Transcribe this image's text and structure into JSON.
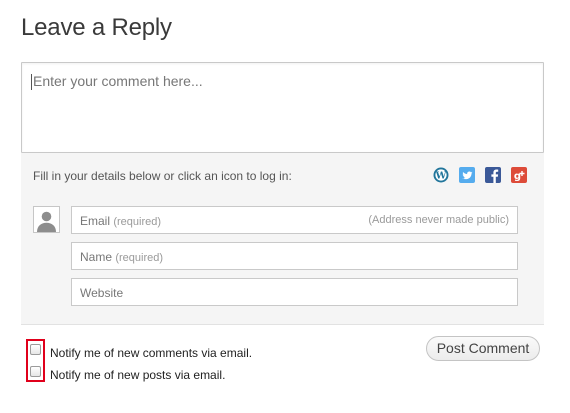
{
  "heading": "Leave a Reply",
  "comment": {
    "placeholder": "Enter your comment here..."
  },
  "details": {
    "prompt": "Fill in your details below or click an icon to log in:",
    "login_icons": [
      "wordpress-icon",
      "twitter-icon",
      "facebook-icon",
      "google-plus-icon"
    ],
    "email": {
      "label": "Email",
      "required": "(required)",
      "note": "(Address never made public)"
    },
    "name": {
      "label": "Name",
      "required": "(required)"
    },
    "website": {
      "label": "Website"
    }
  },
  "subscribe": {
    "comments_label": "Notify me of new comments via email.",
    "posts_label": "Notify me of new posts via email."
  },
  "submit": {
    "label": "Post Comment"
  },
  "colors": {
    "wordpress": "#21759b",
    "twitter": "#55acee",
    "facebook": "#3b5998",
    "google_plus": "#dd4b39",
    "highlight": "#e0001b"
  }
}
